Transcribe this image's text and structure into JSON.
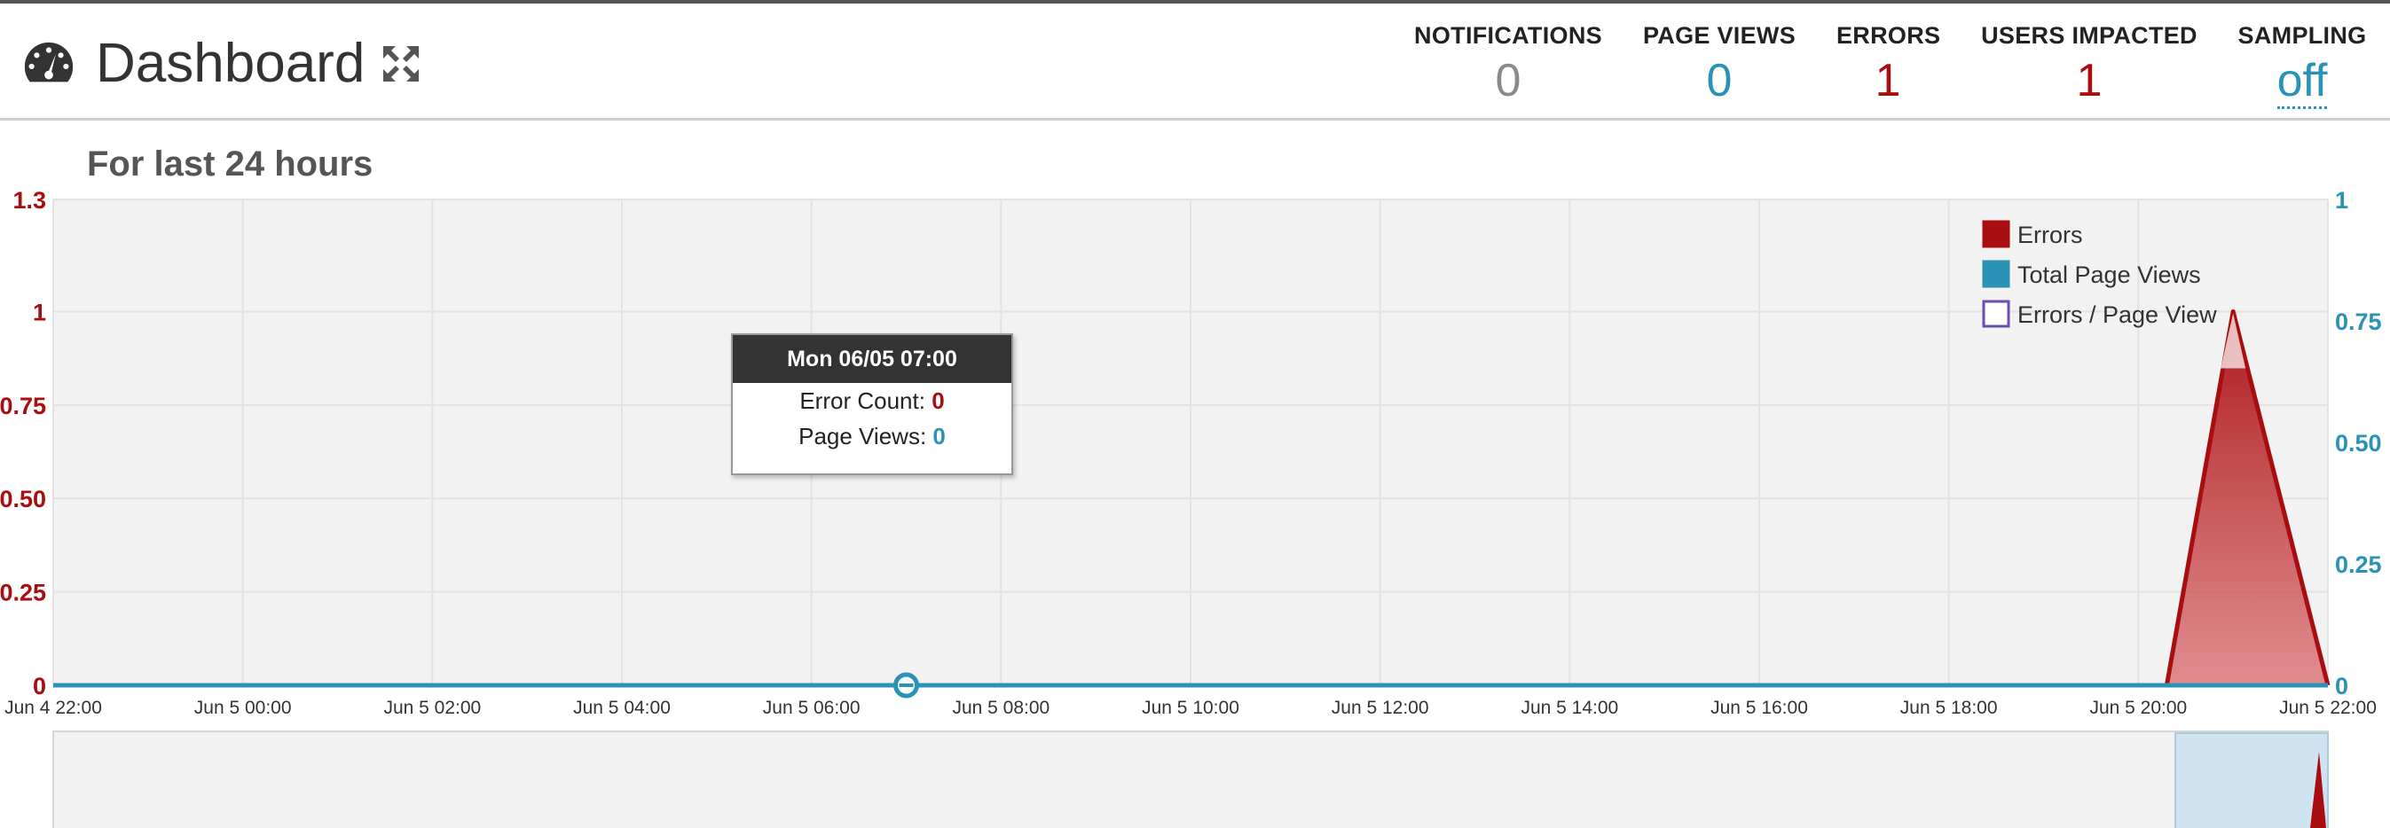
{
  "header": {
    "title": "Dashboard",
    "icon": "dashboard-gauge-icon",
    "expand_icon": "expand-arrows-icon",
    "stats": [
      {
        "label": "NOTIFICATIONS",
        "value": "0",
        "color": "#8a8a8a"
      },
      {
        "label": "PAGE VIEWS",
        "value": "0",
        "color": "#2a93b5"
      },
      {
        "label": "ERRORS",
        "value": "1",
        "color": "#a80d10"
      },
      {
        "label": "USERS IMPACTED",
        "value": "1",
        "color": "#a80d10"
      },
      {
        "label": "SAMPLING",
        "value": "off",
        "color": "#2a93b5"
      }
    ]
  },
  "period_title": "For last 24 hours",
  "tooltip": {
    "title": "Mon 06/05 07:00",
    "error_label": "Error Count:",
    "error_value": "0",
    "pv_label": "Page Views:",
    "pv_value": "0"
  },
  "colors": {
    "errors": "#a80d10",
    "page_views": "#2a93b5",
    "ratio": "#6a4fb0",
    "plot_bg": "#f2f2f2"
  },
  "chart_data": {
    "type": "area",
    "x_tick_labels": [
      "Jun 4 22:00",
      "Jun 5 00:00",
      "Jun 5 02:00",
      "Jun 5 04:00",
      "Jun 5 06:00",
      "Jun 5 08:00",
      "Jun 5 10:00",
      "Jun 5 12:00",
      "Jun 5 14:00",
      "Jun 5 16:00",
      "Jun 5 18:00",
      "Jun 5 20:00",
      "Jun 5 22:00"
    ],
    "x_hours": [
      0,
      2,
      4,
      6,
      8,
      10,
      12,
      14,
      16,
      18,
      20,
      22,
      24
    ],
    "y_left": {
      "ticks": [
        "0",
        "0.25",
        "0.50",
        "0.75",
        "1",
        "1.3"
      ],
      "tick_values": [
        0,
        0.25,
        0.5,
        0.75,
        1,
        1.3
      ],
      "range": [
        0,
        1.3
      ],
      "color": "#a80d10"
    },
    "y_right": {
      "ticks": [
        "0",
        "0.25",
        "0.50",
        "0.75",
        "1"
      ],
      "tick_values": [
        0,
        0.25,
        0.5,
        0.75,
        1
      ],
      "range": [
        0,
        1
      ],
      "color": "#2a93b5"
    },
    "legend": {
      "position": "top-right",
      "items": [
        "Errors",
        "Total Page Views",
        "Errors / Page View"
      ]
    },
    "grid": true,
    "series": [
      {
        "name": "Errors",
        "axis": "left",
        "x": [
          0,
          22.3,
          23,
          24
        ],
        "values": [
          0,
          0,
          1,
          0
        ]
      },
      {
        "name": "Total Page Views",
        "axis": "right",
        "x": [
          0,
          24
        ],
        "values": [
          0,
          0
        ]
      }
    ],
    "hover_point": {
      "x": 9,
      "y": 0
    }
  }
}
